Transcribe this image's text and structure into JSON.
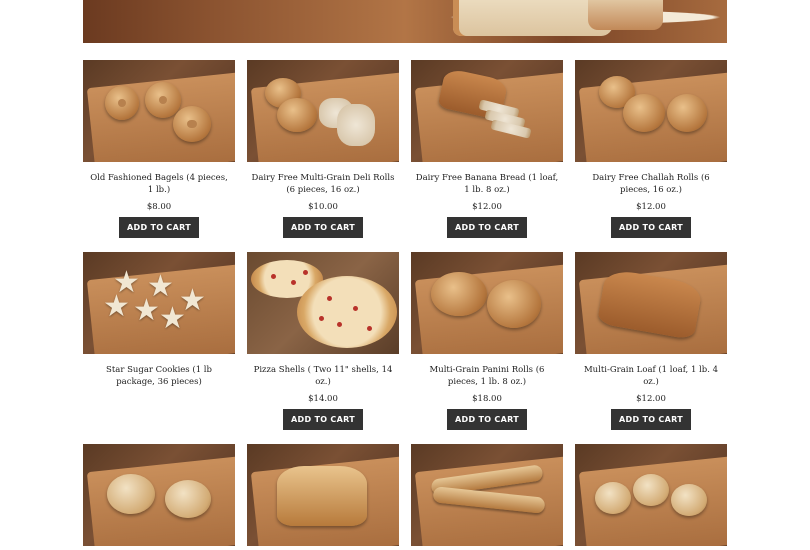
{
  "products": [
    {
      "name": "Old Fashioned Bagels (4 pieces, 1 lb.)",
      "price": "$8.00",
      "button": "ADD TO CART",
      "image_icon": "bagels-image"
    },
    {
      "name": "Dairy Free Multi-Grain Deli Rolls (6 pieces, 16 oz.)",
      "price": "$10.00",
      "button": "ADD TO CART",
      "image_icon": "deli-rolls-image"
    },
    {
      "name": "Dairy Free Banana Bread (1 loaf, 1 lb. 8 oz.)",
      "price": "$12.00",
      "button": "ADD TO CART",
      "image_icon": "banana-bread-image"
    },
    {
      "name": "Dairy Free Challah Rolls (6 pieces, 16 oz.)",
      "price": "$12.00",
      "button": "ADD TO CART",
      "image_icon": "challah-rolls-image"
    },
    {
      "name": "Star Sugar Cookies (1 lb package, 36 pieces)",
      "price": "",
      "button": "",
      "image_icon": "star-cookies-image"
    },
    {
      "name": "Pizza Shells ( Two 11\" shells, 14 oz.)",
      "price": "$14.00",
      "button": "ADD TO CART",
      "image_icon": "pizza-shells-image"
    },
    {
      "name": "Multi-Grain Panini Rolls (6 pieces, 1 lb. 8 oz.)",
      "price": "$18.00",
      "button": "ADD TO CART",
      "image_icon": "panini-rolls-image"
    },
    {
      "name": "Multi-Grain Loaf (1 loaf, 1 lb. 4 oz.)",
      "price": "$12.00",
      "button": "ADD TO CART",
      "image_icon": "multigrain-loaf-image"
    }
  ],
  "bottom_row_images": [
    "boules-image",
    "sandwich-loaf-image",
    "baguettes-image",
    "dinner-rolls-image"
  ],
  "hero_image": "bread-banner-image"
}
